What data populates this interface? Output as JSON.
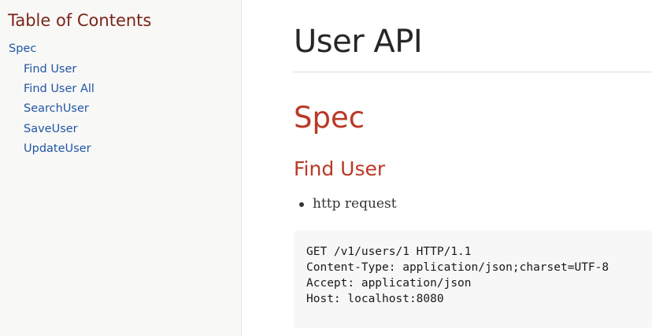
{
  "toc": {
    "title": "Table of Contents",
    "items": [
      {
        "label": "Spec",
        "level": 1
      },
      {
        "label": "Find User",
        "level": 2
      },
      {
        "label": "Find User All",
        "level": 2
      },
      {
        "label": "SearchUser",
        "level": 2
      },
      {
        "label": "SaveUser",
        "level": 2
      },
      {
        "label": "UpdateUser",
        "level": 2
      }
    ]
  },
  "doc": {
    "title": "User API",
    "section_title": "Spec",
    "subsection_title": "Find User",
    "bullets": [
      "http request"
    ],
    "code_lines": [
      "GET /v1/users/1 HTTP/1.1",
      "Content-Type: application/json;charset=UTF-8",
      "Accept: application/json",
      "Host: localhost:8080"
    ]
  },
  "colors": {
    "toc_title": "#7a2518",
    "link": "#2156a5",
    "heading": "#ba3925",
    "sidebar_bg": "#f8f8f7",
    "code_bg": "#f7f7f8"
  }
}
